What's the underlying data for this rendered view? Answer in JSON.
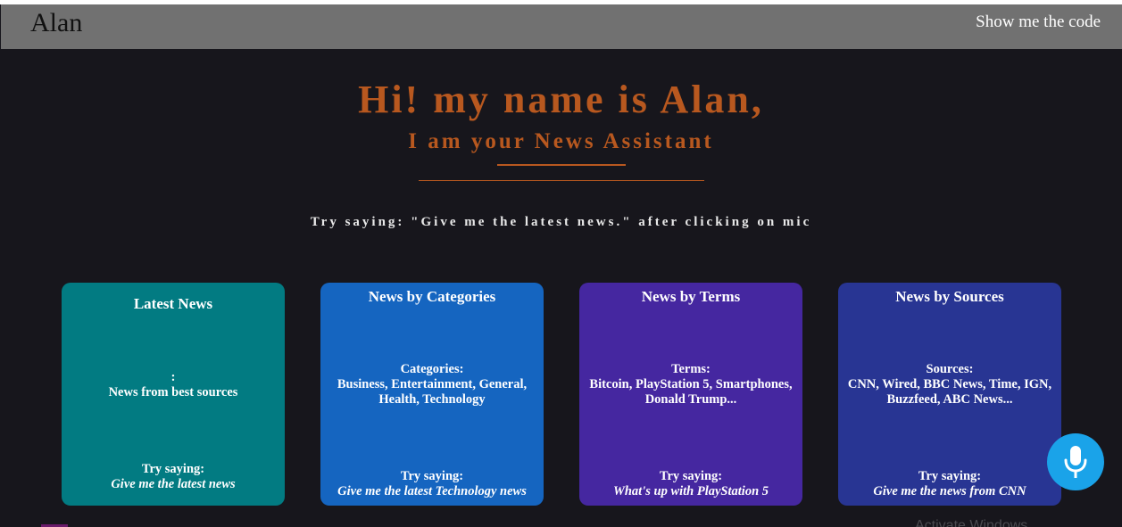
{
  "navbar": {
    "brand": "Alan",
    "code_link": "Show me the code"
  },
  "hero": {
    "title": "Hi! my name is Alan,",
    "subtitle": "I am your News Assistant",
    "hint": "Try saying: \"Give me the latest news.\" after clicking on mic"
  },
  "cards": [
    {
      "title": "Latest News",
      "info_label": ":",
      "info_text": "News from best sources",
      "try_label": "Try saying:",
      "try_example": "Give me the latest news",
      "color": "#027b82"
    },
    {
      "title": "News by Categories",
      "info_label": "Categories:",
      "info_text": "Business, Entertainment, General, Health, Technology",
      "try_label": "Try saying:",
      "try_example": "Give me the latest Technology news",
      "color": "#1565c0"
    },
    {
      "title": "News by Terms",
      "info_label": "Terms:",
      "info_text": "Bitcoin, PlayStation 5, Smartphones, Donald Trump...",
      "try_label": "Try saying:",
      "try_example": "What's up with PlayStation 5",
      "color": "#4527a0"
    },
    {
      "title": "News by Sources",
      "info_label": "Sources:",
      "info_text": "CNN, Wired, BBC News, Time, IGN, Buzzfeed, ABC News...",
      "try_label": "Try saying:",
      "try_example": "Give me the news from CNN",
      "color": "#283593"
    }
  ],
  "mic": {
    "icon": "microphone-icon",
    "color": "#1aa3e9"
  },
  "watermark": "Activate Windows",
  "colors": {
    "background": "#17161c",
    "navbar": "#717171",
    "accent": "#b8581f"
  }
}
